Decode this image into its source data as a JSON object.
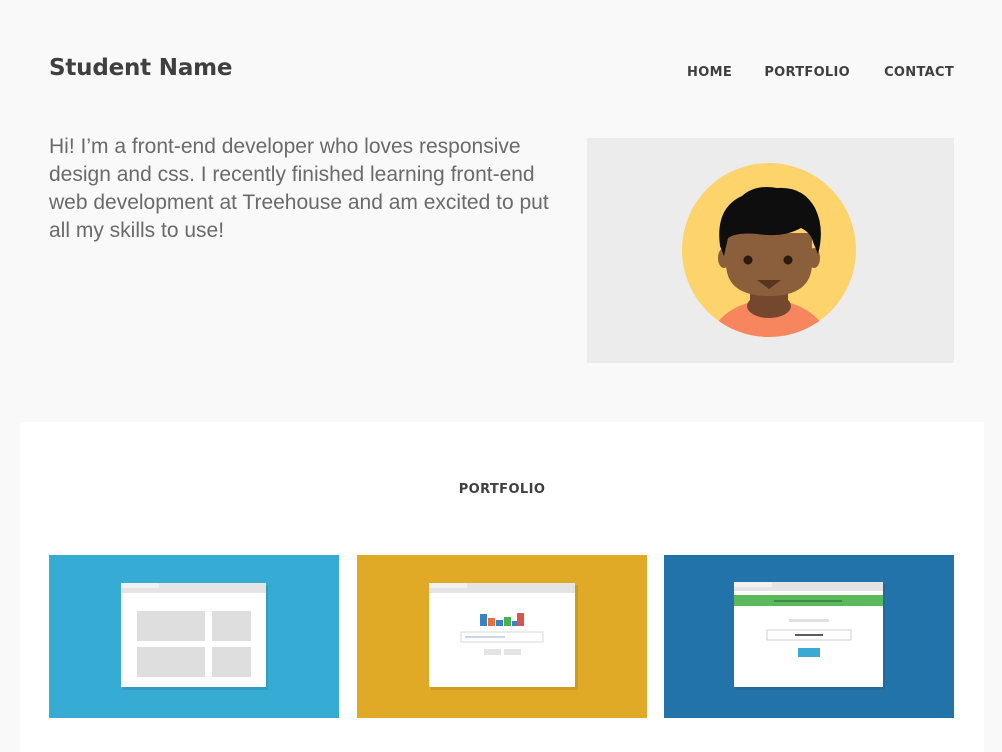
{
  "header": {
    "brand": "Student Name",
    "nav": [
      "HOME",
      "PORTFOLIO",
      "CONTACT"
    ]
  },
  "intro": {
    "text": "Hi! I’m a front-end developer who loves responsive design and css. I recently finished learning front-end web development at Treehouse and am excited to put all my skills to use!"
  },
  "portfolio": {
    "title": "PORTFOLIO",
    "cards": [
      {
        "icon": "browser-grid-layout-icon",
        "color": "#36abd4"
      },
      {
        "icon": "browser-chart-search-icon",
        "color": "#e0aa27"
      },
      {
        "icon": "browser-login-form-icon",
        "color": "#2373ab"
      }
    ]
  },
  "colors": {
    "page_bg": "#f9f9f9",
    "avatar_bg": "#ececec",
    "avatar_circle": "#fdd36b",
    "skin": "#8b5e3c",
    "shirt": "#f7855d"
  }
}
